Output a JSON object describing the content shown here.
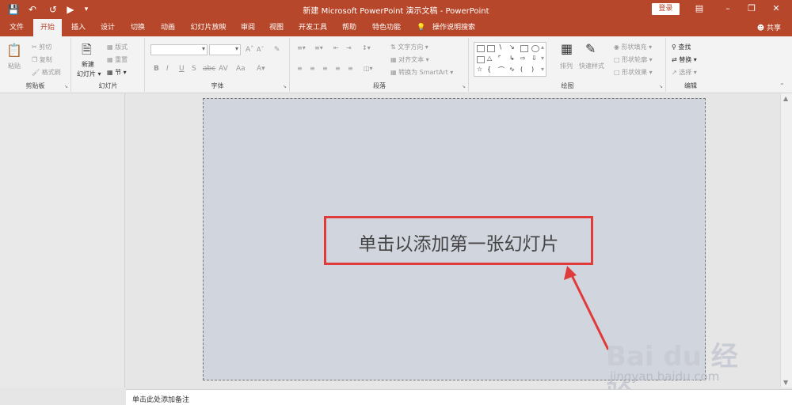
{
  "window": {
    "title": "新建 Microsoft PowerPoint 演示文稿 - PowerPoint",
    "login_label": "登录",
    "share_label": "共享"
  },
  "tabs": [
    "文件",
    "开始",
    "插入",
    "设计",
    "切换",
    "动画",
    "幻灯片放映",
    "审阅",
    "视图",
    "开发工具",
    "帮助",
    "特色功能"
  ],
  "tell_me": "操作说明搜索",
  "ribbon": {
    "clipboard": {
      "label": "剪贴板",
      "paste": "粘贴",
      "cut": "剪切",
      "copy": "复制",
      "format_painter": "格式刷"
    },
    "slides": {
      "label": "幻灯片",
      "new_slide": "新建",
      "new_slide2": "幻灯片",
      "layout": "版式",
      "reset": "重置",
      "section": "节"
    },
    "font": {
      "label": "字体",
      "b": "B",
      "i": "I",
      "u": "U",
      "s": "S",
      "abc": "abc",
      "av": "AV",
      "aa": "Aa",
      "grow": "A",
      "shrink": "A"
    },
    "paragraph": {
      "label": "段落",
      "text_direction": "文字方向",
      "align_text": "对齐文本",
      "smartart": "转换为 SmartArt"
    },
    "drawing": {
      "label": "绘图",
      "arrange": "排列",
      "quick_styles": "快速样式",
      "fill": "形状填充",
      "outline": "形状轮廓",
      "effects": "形状效果"
    },
    "editing": {
      "label": "编辑",
      "find": "查找",
      "replace": "替换",
      "select": "选择"
    }
  },
  "slide": {
    "placeholder": "单击以添加第一张幻灯片"
  },
  "notes": {
    "placeholder": "单击此处添加备注"
  },
  "watermark": {
    "brand": "Bai du 经验",
    "url": "jingyan.baidu.com"
  },
  "colors": {
    "accent": "#b7472a",
    "highlight": "#e03b3b",
    "slide_bg": "#d1d5de"
  }
}
